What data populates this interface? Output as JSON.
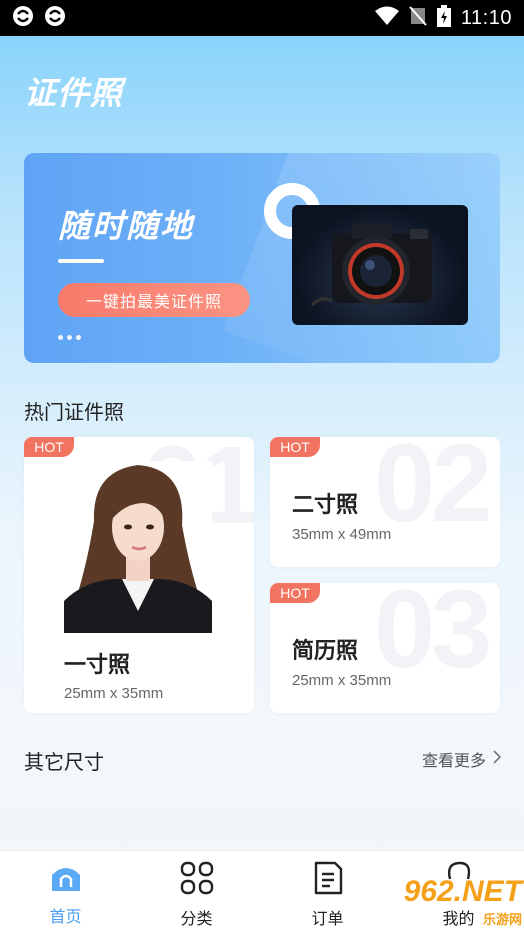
{
  "status_bar": {
    "time": "11:10"
  },
  "header": {
    "title": "证件照"
  },
  "banner": {
    "title": "随时随地",
    "cta": "一键拍最美证件照"
  },
  "hot_section": {
    "title": "热门证件照",
    "badge": "HOT",
    "items": [
      {
        "name": "一寸照",
        "size": "25mm x 35mm",
        "bg_number": "01"
      },
      {
        "name": "二寸照",
        "size": "35mm x 49mm",
        "bg_number": "02"
      },
      {
        "name": "简历照",
        "size": "25mm x 35mm",
        "bg_number": "03"
      }
    ]
  },
  "other_section": {
    "title": "其它尺寸",
    "more": "查看更多"
  },
  "tabbar": {
    "items": [
      {
        "label": "首页",
        "icon": "home-icon",
        "active": true
      },
      {
        "label": "分类",
        "icon": "grid-icon",
        "active": false
      },
      {
        "label": "订单",
        "icon": "document-icon",
        "active": false
      },
      {
        "label": "我的",
        "icon": "user-icon",
        "active": false
      }
    ]
  },
  "watermark": {
    "big": "962.NET",
    "small": "乐游网"
  },
  "colors": {
    "accent": "#4a9ef3",
    "hot": "#f2735f",
    "cta": "#f87a6a"
  }
}
